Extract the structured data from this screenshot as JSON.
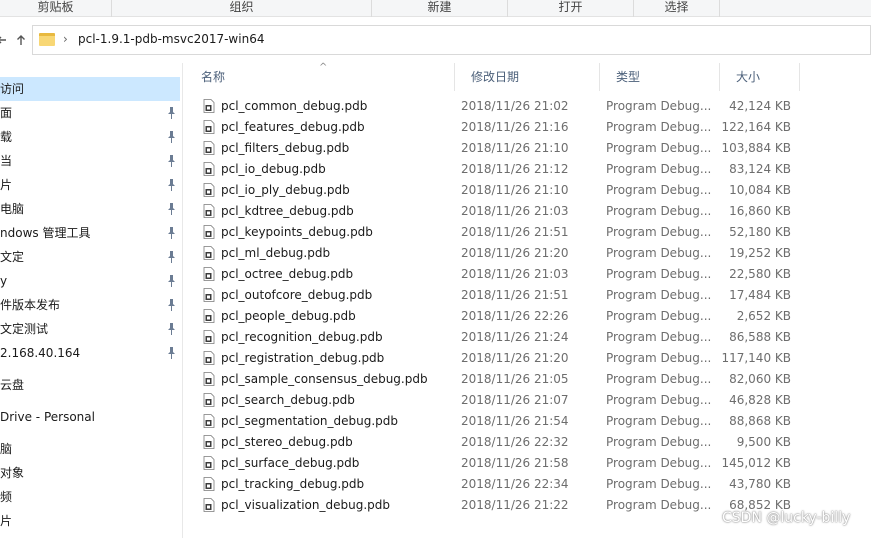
{
  "ribbon": {
    "groups": [
      "剪贴板",
      "组织",
      "新建",
      "打开",
      "选择"
    ]
  },
  "address": {
    "back_icon": "arrow-left-icon",
    "up_icon": "arrow-up-icon",
    "path": "pcl-1.9.1-pdb-msvc2017-win64"
  },
  "sidebar": {
    "items": [
      {
        "label": "访问",
        "pinned": false,
        "selected": true
      },
      {
        "label": "面",
        "pinned": true,
        "selected": false
      },
      {
        "label": "载",
        "pinned": true,
        "selected": false
      },
      {
        "label": "当",
        "pinned": true,
        "selected": false
      },
      {
        "label": "片",
        "pinned": true,
        "selected": false
      },
      {
        "label": "电脑",
        "pinned": true,
        "selected": false
      },
      {
        "label": "ndows 管理工具",
        "pinned": true,
        "selected": false
      },
      {
        "label": "文定",
        "pinned": true,
        "selected": false
      },
      {
        "label": "y",
        "pinned": true,
        "selected": false
      },
      {
        "label": "件版本发布",
        "pinned": true,
        "selected": false
      },
      {
        "label": "文定测试",
        "pinned": true,
        "selected": false
      },
      {
        "label": "2.168.40.164",
        "pinned": true,
        "selected": false
      },
      {
        "label": "云盘",
        "pinned": false,
        "selected": false
      },
      {
        "label": "Drive - Personal",
        "pinned": false,
        "selected": false
      },
      {
        "label": "脑",
        "pinned": false,
        "selected": false
      },
      {
        "label": "对象",
        "pinned": false,
        "selected": false
      },
      {
        "label": "频",
        "pinned": false,
        "selected": false
      },
      {
        "label": "片",
        "pinned": false,
        "selected": false
      }
    ]
  },
  "columns": {
    "name": "名称",
    "modified": "修改日期",
    "type": "类型",
    "size": "大小"
  },
  "files": [
    {
      "name": "pcl_common_debug.pdb",
      "modified": "2018/11/26 21:02",
      "type": "Program Debug...",
      "size": "42,124 KB"
    },
    {
      "name": "pcl_features_debug.pdb",
      "modified": "2018/11/26 21:16",
      "type": "Program Debug...",
      "size": "122,164 KB"
    },
    {
      "name": "pcl_filters_debug.pdb",
      "modified": "2018/11/26 21:10",
      "type": "Program Debug...",
      "size": "103,884 KB"
    },
    {
      "name": "pcl_io_debug.pdb",
      "modified": "2018/11/26 21:12",
      "type": "Program Debug...",
      "size": "83,124 KB"
    },
    {
      "name": "pcl_io_ply_debug.pdb",
      "modified": "2018/11/26 21:10",
      "type": "Program Debug...",
      "size": "10,084 KB"
    },
    {
      "name": "pcl_kdtree_debug.pdb",
      "modified": "2018/11/26 21:03",
      "type": "Program Debug...",
      "size": "16,860 KB"
    },
    {
      "name": "pcl_keypoints_debug.pdb",
      "modified": "2018/11/26 21:51",
      "type": "Program Debug...",
      "size": "52,180 KB"
    },
    {
      "name": "pcl_ml_debug.pdb",
      "modified": "2018/11/26 21:20",
      "type": "Program Debug...",
      "size": "19,252 KB"
    },
    {
      "name": "pcl_octree_debug.pdb",
      "modified": "2018/11/26 21:03",
      "type": "Program Debug...",
      "size": "22,580 KB"
    },
    {
      "name": "pcl_outofcore_debug.pdb",
      "modified": "2018/11/26 21:51",
      "type": "Program Debug...",
      "size": "17,484 KB"
    },
    {
      "name": "pcl_people_debug.pdb",
      "modified": "2018/11/26 22:26",
      "type": "Program Debug...",
      "size": "2,652 KB"
    },
    {
      "name": "pcl_recognition_debug.pdb",
      "modified": "2018/11/26 21:24",
      "type": "Program Debug...",
      "size": "86,588 KB"
    },
    {
      "name": "pcl_registration_debug.pdb",
      "modified": "2018/11/26 21:20",
      "type": "Program Debug...",
      "size": "117,140 KB"
    },
    {
      "name": "pcl_sample_consensus_debug.pdb",
      "modified": "2018/11/26 21:05",
      "type": "Program Debug...",
      "size": "82,060 KB"
    },
    {
      "name": "pcl_search_debug.pdb",
      "modified": "2018/11/26 21:07",
      "type": "Program Debug...",
      "size": "46,828 KB"
    },
    {
      "name": "pcl_segmentation_debug.pdb",
      "modified": "2018/11/26 21:54",
      "type": "Program Debug...",
      "size": "88,868 KB"
    },
    {
      "name": "pcl_stereo_debug.pdb",
      "modified": "2018/11/26 22:32",
      "type": "Program Debug...",
      "size": "9,500 KB"
    },
    {
      "name": "pcl_surface_debug.pdb",
      "modified": "2018/11/26 21:58",
      "type": "Program Debug...",
      "size": "145,012 KB"
    },
    {
      "name": "pcl_tracking_debug.pdb",
      "modified": "2018/11/26 22:34",
      "type": "Program Debug...",
      "size": "43,780 KB"
    },
    {
      "name": "pcl_visualization_debug.pdb",
      "modified": "2018/11/26 21:22",
      "type": "Program Debug...",
      "size": "68,852 KB"
    }
  ],
  "watermark": "CSDN @lucky-billy",
  "colors": {
    "selected_bg": "#cce8ff",
    "header_text": "#4c607a",
    "folder_yellow": "#f8d775"
  }
}
